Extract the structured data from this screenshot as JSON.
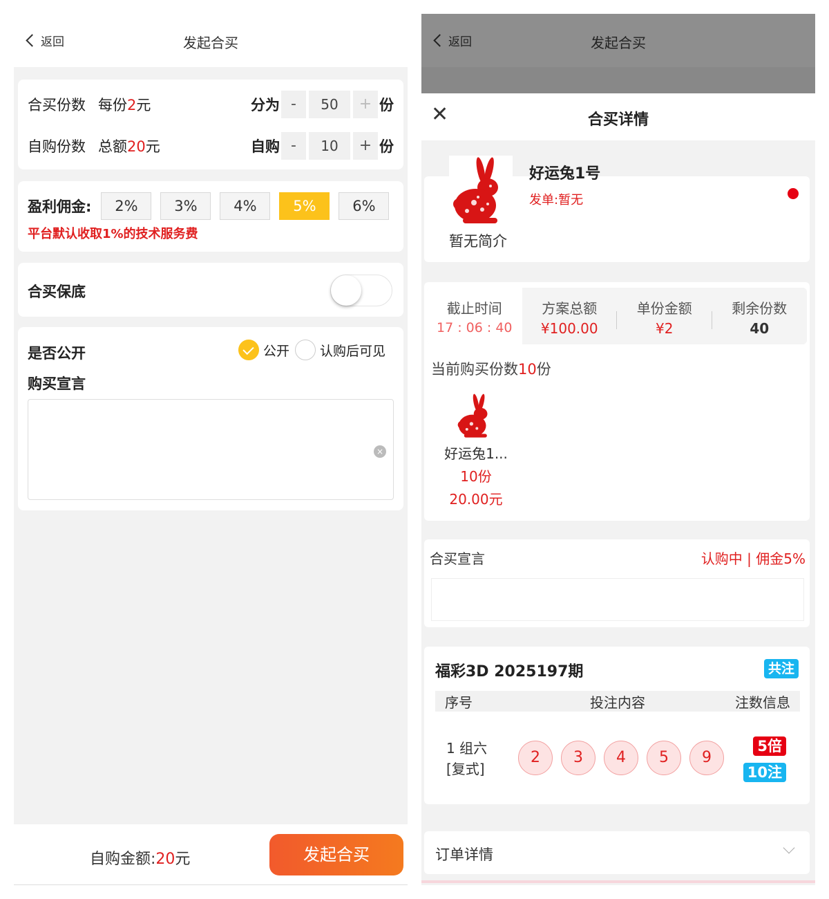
{
  "left": {
    "nav": {
      "back_label": "返回",
      "title": "发起合买"
    },
    "shares": {
      "label": "合买份数",
      "price_prefix": "每份",
      "price_value": "2",
      "price_unit": "元",
      "split_label": "分为",
      "minus": "-",
      "value": "50",
      "plus": "+",
      "unit": "份"
    },
    "self_buy": {
      "label": "自购份数",
      "total_prefix": "总额",
      "total_value": "20",
      "total_unit": "元",
      "ctl_label": "自购",
      "minus": "-",
      "value": "10",
      "plus": "+",
      "unit": "份"
    },
    "commission": {
      "label": "盈利佣金:",
      "options": [
        "2%",
        "3%",
        "4%",
        "5%",
        "6%"
      ],
      "selected": "5%",
      "notice": "平台默认收取1%的技术服务费"
    },
    "guarantee": {
      "label": "合买保底",
      "enabled": false
    },
    "visibility": {
      "label": "是否公开",
      "option_public": "公开",
      "option_after": "认购后可见",
      "selected": "公开"
    },
    "declaration": {
      "label": "购买宣言",
      "value": ""
    },
    "footer": {
      "amount_label": "自购金额:",
      "amount_value": "20",
      "amount_unit": "元",
      "submit_label": "发起合买"
    }
  },
  "right": {
    "nav": {
      "back_label": "返回",
      "title": "发起合买"
    },
    "sheet_title": "合买详情",
    "profile": {
      "name": "好运兔1号",
      "issuer": "发单:暂无",
      "intro": "暂无简介"
    },
    "stats": {
      "deadline_label": "截止时间",
      "deadline_value": "17 : 06 : 40",
      "total_label": "方案总额",
      "total_value": "¥100.00",
      "unit_label": "单份金额",
      "unit_value": "¥2",
      "remain_label": "剩余份数",
      "remain_value": "40"
    },
    "current": {
      "prefix": "当前购买份数",
      "count": "10",
      "suffix": "份"
    },
    "buyer": {
      "name": "好运兔1...",
      "shares": "10份",
      "amount": "20.00元"
    },
    "declaration": {
      "title": "合买宣言",
      "status": "认购中 | 佣金5%"
    },
    "lottery": {
      "title": "福彩3D 2025197期",
      "badge": "共注",
      "col_seq": "序号",
      "col_content": "投注内容",
      "col_info": "注数信息",
      "row_seq": "1 组六",
      "row_type": "[复式]",
      "balls": [
        "2",
        "3",
        "4",
        "5",
        "9"
      ],
      "multiplier": "5倍",
      "count": "10注"
    },
    "order_details": "订单详情"
  },
  "colors": {
    "accent_yellow": "#fcc21b",
    "red": "#e02020",
    "blue_badge": "#18b5f0",
    "submit_gradient_start": "#f25a2c",
    "submit_gradient_end": "#f47a1f"
  },
  "icons": [
    "chevron-left-icon",
    "close-icon",
    "check-icon",
    "clear-icon",
    "rabbit-logo",
    "chevron-down-icon"
  ]
}
